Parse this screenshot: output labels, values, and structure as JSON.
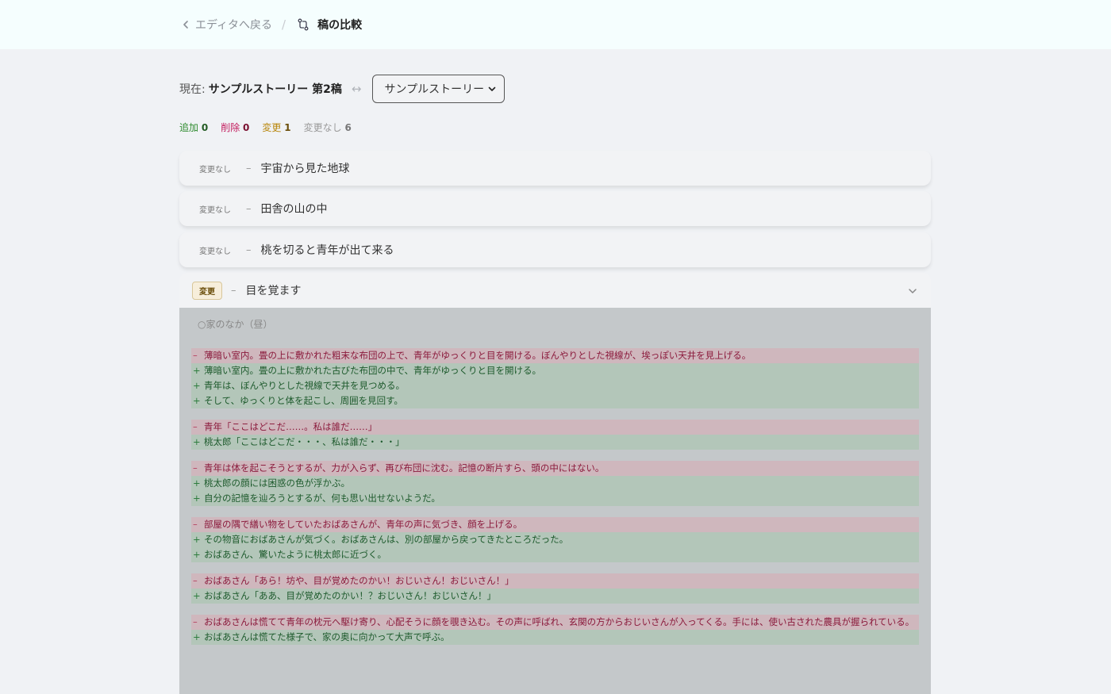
{
  "header": {
    "back_label": "エディタへ戻る",
    "separator": "/",
    "title": "稿の比較"
  },
  "compare": {
    "current_label": "現在:",
    "current_name": "サンプルストーリー 第2稿",
    "swap_symbol": "↔",
    "selected_draft": "サンプルストーリー"
  },
  "stats": {
    "added_label": "追加",
    "added_count": "0",
    "deleted_label": "削除",
    "deleted_count": "0",
    "changed_label": "変更",
    "changed_count": "1",
    "unchanged_label": "変更なし",
    "unchanged_count": "6"
  },
  "scenes": [
    {
      "badge": "変更なし",
      "dash": "–",
      "title": "宇宙から見た地球"
    },
    {
      "badge": "変更なし",
      "dash": "–",
      "title": "田舎の山の中"
    },
    {
      "badge": "変更なし",
      "dash": "–",
      "title": "桃を切ると青年が出て来る"
    }
  ],
  "changed_scene": {
    "badge": "変更",
    "dash": "–",
    "title": "目を覚ます",
    "location": "○家のなか（昼）",
    "blocks": [
      {
        "lines": [
          {
            "type": "del",
            "sign": "–",
            "text": "薄暗い室内。畳の上に敷かれた粗末な布団の上で、青年がゆっくりと目を開ける。ぼんやりとした視線が、埃っぽい天井を見上げる。"
          },
          {
            "type": "add",
            "sign": "+",
            "text": "薄暗い室内。畳の上に敷かれた古びた布団の中で、青年がゆっくりと目を開ける。"
          },
          {
            "type": "add",
            "sign": "+",
            "text": "青年は、ぼんやりとした視線で天井を見つめる。"
          },
          {
            "type": "add",
            "sign": "+",
            "text": "そして、ゆっくりと体を起こし、周囲を見回す。"
          }
        ]
      },
      {
        "lines": [
          {
            "type": "del",
            "sign": "–",
            "text": "青年「ここはどこだ……。私は誰だ……」"
          },
          {
            "type": "add",
            "sign": "+",
            "text": "桃太郎「ここはどこだ・・・、私は誰だ・・・」"
          }
        ]
      },
      {
        "lines": [
          {
            "type": "del",
            "sign": "–",
            "text": "青年は体を起こそうとするが、力が入らず、再び布団に沈む。記憶の断片すら、頭の中にはない。"
          },
          {
            "type": "add",
            "sign": "+",
            "text": "桃太郎の顔には困惑の色が浮かぶ。"
          },
          {
            "type": "add",
            "sign": "+",
            "text": "自分の記憶を辿ろうとするが、何も思い出せないようだ。"
          }
        ]
      },
      {
        "lines": [
          {
            "type": "del",
            "sign": "–",
            "text": "部屋の隅で繕い物をしていたおばあさんが、青年の声に気づき、顔を上げる。"
          },
          {
            "type": "add",
            "sign": "+",
            "text": "その物音におばあさんが気づく。おばあさんは、別の部屋から戻ってきたところだった。"
          },
          {
            "type": "add",
            "sign": "+",
            "text": "おばあさん、驚いたように桃太郎に近づく。"
          }
        ]
      },
      {
        "lines": [
          {
            "type": "del",
            "sign": "–",
            "text": "おばあさん「あら！坊や、目が覚めたのかい！おじいさん！おじいさん！」"
          },
          {
            "type": "add",
            "sign": "+",
            "text": "おばあさん「ああ、目が覚めたのかい！？おじいさん！おじいさん！」"
          }
        ]
      },
      {
        "lines": [
          {
            "type": "del",
            "sign": "–",
            "text": "おばあさんは慌てて青年の枕元へ駆け寄り、心配そうに顔を覗き込む。その声に呼ばれ、玄関の方からおじいさんが入ってくる。手には、使い古された農具が握られている。"
          },
          {
            "type": "add",
            "sign": "+",
            "text": "おばあさんは慌てた様子で、家の奥に向かって大声で呼ぶ。"
          }
        ]
      }
    ]
  },
  "colors": {
    "added": "#2e8b2e",
    "deleted": "#c2185b",
    "changed": "#b8860b",
    "del_bg": "#cfb7bd",
    "add_bg": "#b3c6b9"
  },
  "icons": [
    "chevron-left-icon",
    "compare-icon",
    "swap-icon",
    "select-chevron-icon",
    "chevron-down-icon"
  ]
}
